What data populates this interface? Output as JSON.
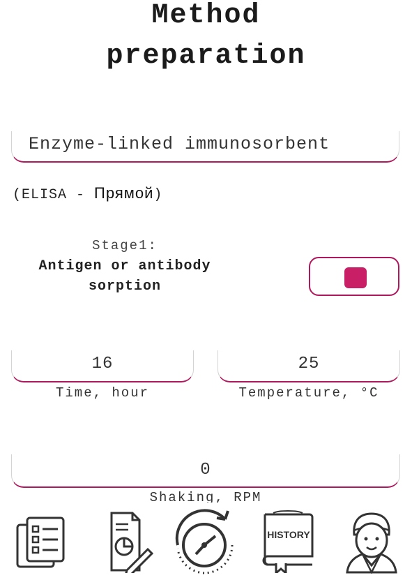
{
  "title": {
    "line1": "Method",
    "line2": "preparation"
  },
  "method": {
    "value": "Enzyme-linked immunosorbent"
  },
  "method_type": {
    "prefix": "(ELISA - ",
    "name": "Прямой",
    "suffix": ")"
  },
  "stage": {
    "label": "Stage1:",
    "name_line1": "Antigen or antibody",
    "name_line2": "sorption",
    "toggle_on": true
  },
  "fields": {
    "time": {
      "value": "16",
      "label": "Time, hour"
    },
    "temperature": {
      "value": "25",
      "label": "Temperature, °C"
    },
    "shaking": {
      "value": "0",
      "label": "Shaking, RPM"
    }
  },
  "nav": {
    "history_label": "HISTORY",
    "items": [
      "checklist-icon",
      "report-icon",
      "timer-icon",
      "history-book-icon",
      "doctor-avatar-icon"
    ]
  },
  "colors": {
    "accent": "#b0185e",
    "toggle_knob": "#c81f66"
  }
}
